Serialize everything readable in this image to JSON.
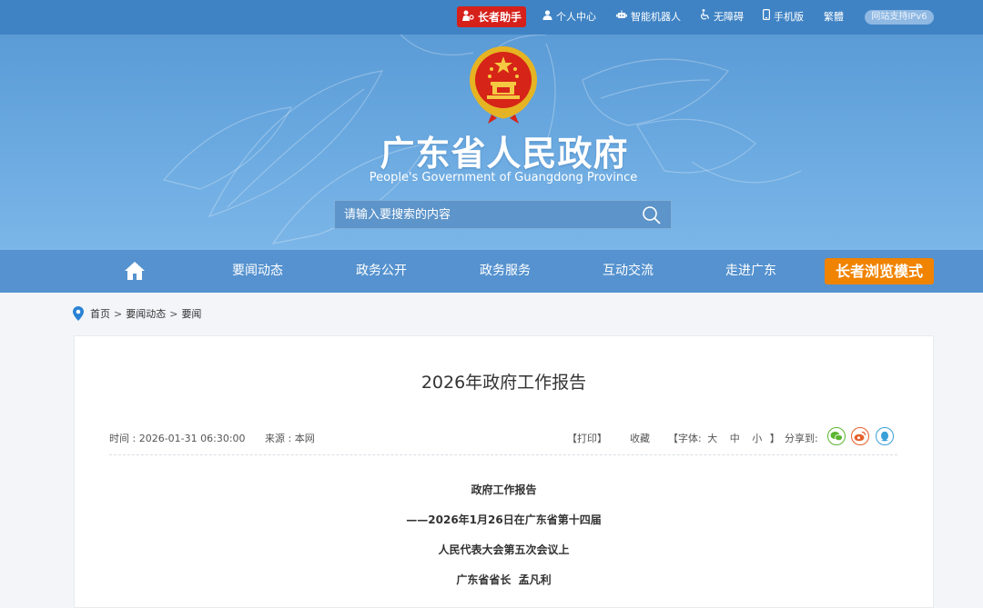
{
  "topbar": {
    "elder_helper": "长者助手",
    "personal_center": "个人中心",
    "robot": "智能机器人",
    "accessible": "无障碍",
    "mobile": "手机版",
    "traditional": "繁體",
    "ipv6": "网站支持IPv6"
  },
  "banner": {
    "title": "广东省人民政府",
    "subtitle": "People's Government of Guangdong Province",
    "search_placeholder": "请输入要搜索的内容"
  },
  "nav": {
    "items": [
      "要闻动态",
      "政务公开",
      "政务服务",
      "互动交流",
      "走进广东"
    ],
    "elder_mode": "长者浏览模式"
  },
  "breadcrumb": [
    "首页",
    "要闻动态",
    "要闻"
  ],
  "article": {
    "title": "2026年政府工作报告",
    "time": "时间 : 2026-01-31 06:30:00",
    "source": "来源 : 本网",
    "print": "【打印】",
    "favorite": "收藏",
    "font_open": "【字体:",
    "font_large": "大",
    "font_medium": "中",
    "font_small": "小",
    "font_close": "】",
    "share_to": "分享到:",
    "body": [
      "政府工作报告",
      "——2026年1月26日在广东省第十四届",
      "人民代表大会第五次会议上",
      "广东省省长  孟凡利"
    ]
  },
  "colors": {
    "topbar": "#3f83c4",
    "nav": "#5592cf",
    "elder_red": "#d6201a",
    "elder_orange": "#f08300",
    "wechat": "#5bb531",
    "weibo": "#e6602b",
    "qq": "#3aa0d8"
  }
}
